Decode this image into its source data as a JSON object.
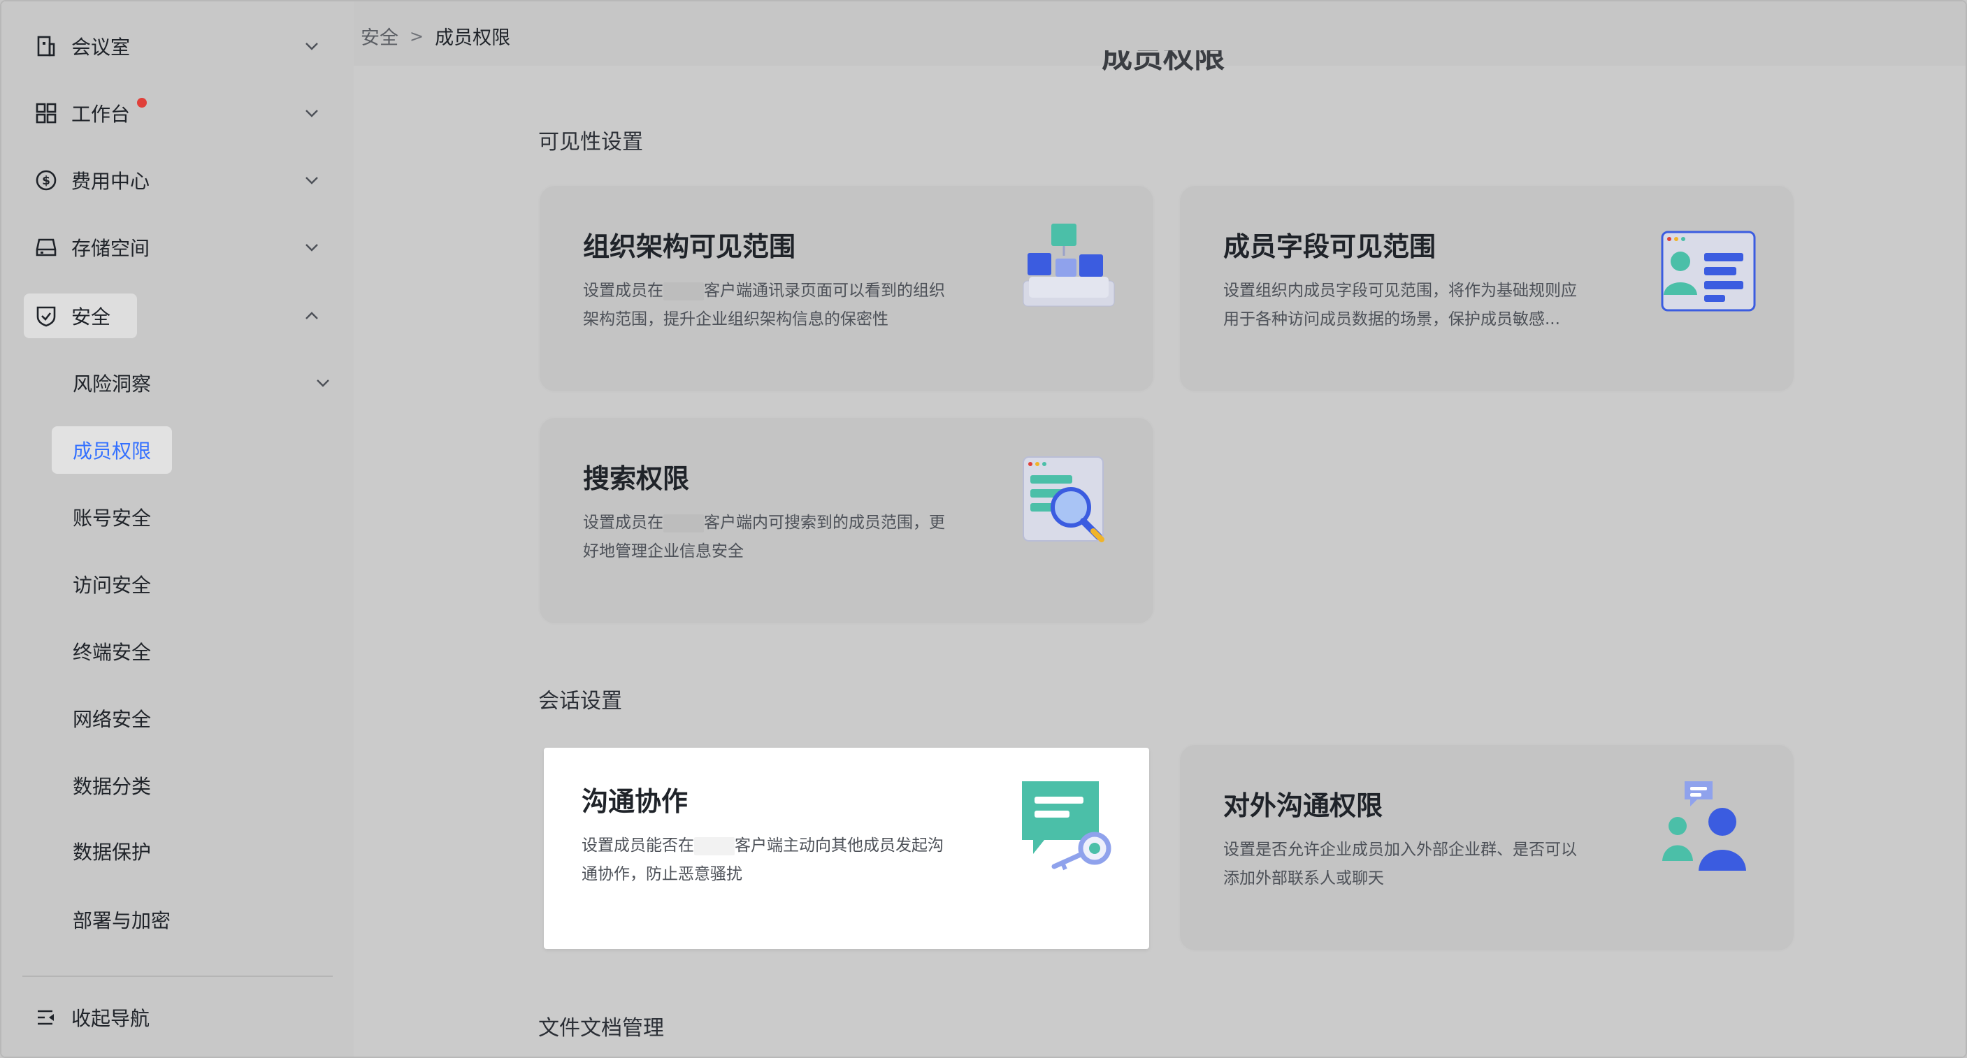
{
  "sidebar": {
    "items": [
      {
        "label": "会议室",
        "icon": "building-icon"
      },
      {
        "label": "工作台",
        "icon": "grid-icon",
        "badge": "red-dot"
      },
      {
        "label": "费用中心",
        "icon": "dollar-icon"
      },
      {
        "label": "存储空间",
        "icon": "drive-icon"
      },
      {
        "label": "安全",
        "icon": "shield-icon",
        "expanded": true
      }
    ],
    "security_children": [
      {
        "label": "风险洞察"
      },
      {
        "label": "成员权限",
        "active": true
      },
      {
        "label": "账号安全"
      },
      {
        "label": "访问安全"
      },
      {
        "label": "终端安全"
      },
      {
        "label": "网络安全"
      },
      {
        "label": "数据分类"
      },
      {
        "label": "数据保护"
      },
      {
        "label": "部署与加密"
      }
    ],
    "collapse_label": "收起导航"
  },
  "breadcrumb": {
    "parent": "安全",
    "separator": ">",
    "current": "成员权限"
  },
  "page_title_clipped": "成员权限",
  "sections": {
    "visibility": {
      "title": "可见性设置",
      "cards": [
        {
          "title": "组织架构可见范围",
          "desc_a": "设置成员在",
          "desc_b": "客户端通讯录页面可以看到的组织架构范围，提升企业组织架构信息的保密性"
        },
        {
          "title": "成员字段可见范围",
          "desc_a": "设置组织内成员字段可见范围，将作为基础规则应用于各种访问成员数据的场景，保护成员敏感..."
        },
        {
          "title": "搜索权限",
          "desc_a": "设置成员在",
          "desc_b": "客户端内可搜索到的成员范围，更好地管理企业信息安全"
        }
      ]
    },
    "chat": {
      "title": "会话设置",
      "cards": [
        {
          "title": "沟通协作",
          "desc_a": "设置成员能否在",
          "desc_b": "客户端主动向其他成员发起沟通协作，防止恶意骚扰"
        },
        {
          "title": "对外沟通权限",
          "desc_a": "设置是否允许企业成员加入外部企业群、是否可以添加外部联系人或聊天"
        }
      ]
    },
    "files": {
      "title": "文件文档管理"
    }
  },
  "colors": {
    "accent": "#3370ff",
    "badge": "#e0403a",
    "illus_blue": "#3b5ce0",
    "illus_teal": "#4bbfa8"
  }
}
